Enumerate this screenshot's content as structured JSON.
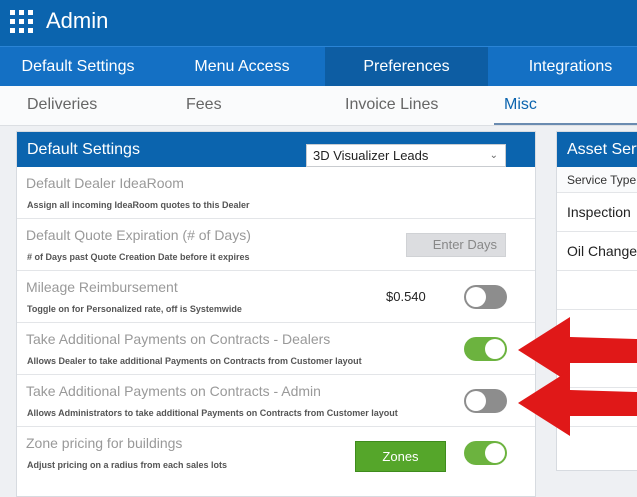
{
  "app": {
    "title": "Admin",
    "apps_icon": "grid-icon"
  },
  "main_tabs": [
    {
      "label": "Default Settings",
      "active": false
    },
    {
      "label": "Menu Access",
      "active": false
    },
    {
      "label": "Preferences",
      "active": true
    },
    {
      "label": "Integrations",
      "active": false
    }
  ],
  "sub_tabs": [
    {
      "label": "Deliveries",
      "active": false
    },
    {
      "label": "Fees",
      "active": false
    },
    {
      "label": "Invoice Lines",
      "active": false
    },
    {
      "label": "Misc",
      "active": true
    }
  ],
  "default_settings": {
    "title": "Default Settings",
    "rows": [
      {
        "title": "Default Dealer IdeaRoom",
        "description": "Assign all incoming IdeaRoom quotes to this Dealer",
        "select_value": "3D Visualizer Leads"
      },
      {
        "title": "Default Quote Expiration (# of Days)",
        "description": "# of Days past Quote Creation Date before it expires",
        "input_placeholder": "Enter Days"
      },
      {
        "title": "Mileage Reimbursement",
        "description": "Toggle on for Personalized rate, off is Systemwide",
        "rate": "$0.540",
        "toggle_on": false
      },
      {
        "title": "Take Additional Payments on Contracts - Dealers",
        "description": "Allows Dealer to take additional Payments on Contracts from Customer layout",
        "toggle_on": true
      },
      {
        "title": "Take Additional Payments on Contracts - Admin",
        "description": "Allows Administrators to take additional Payments on Contracts from Customer layout",
        "toggle_on": false
      },
      {
        "title": "Zone pricing for buildings",
        "description": "Adjust pricing on a radius from each sales lots",
        "button_label": "Zones",
        "toggle_on": true
      }
    ]
  },
  "asset_service": {
    "title": "Asset Serv",
    "column": "Service Type",
    "rows": [
      "Inspection",
      "Oil Change",
      "",
      "",
      "",
      ""
    ]
  },
  "colors": {
    "brand": "#0b64ae",
    "toggle_on": "#6cb33f",
    "toggle_off": "#8d8d8d",
    "arrow": "#e01818",
    "zones_button": "#55a62a"
  }
}
